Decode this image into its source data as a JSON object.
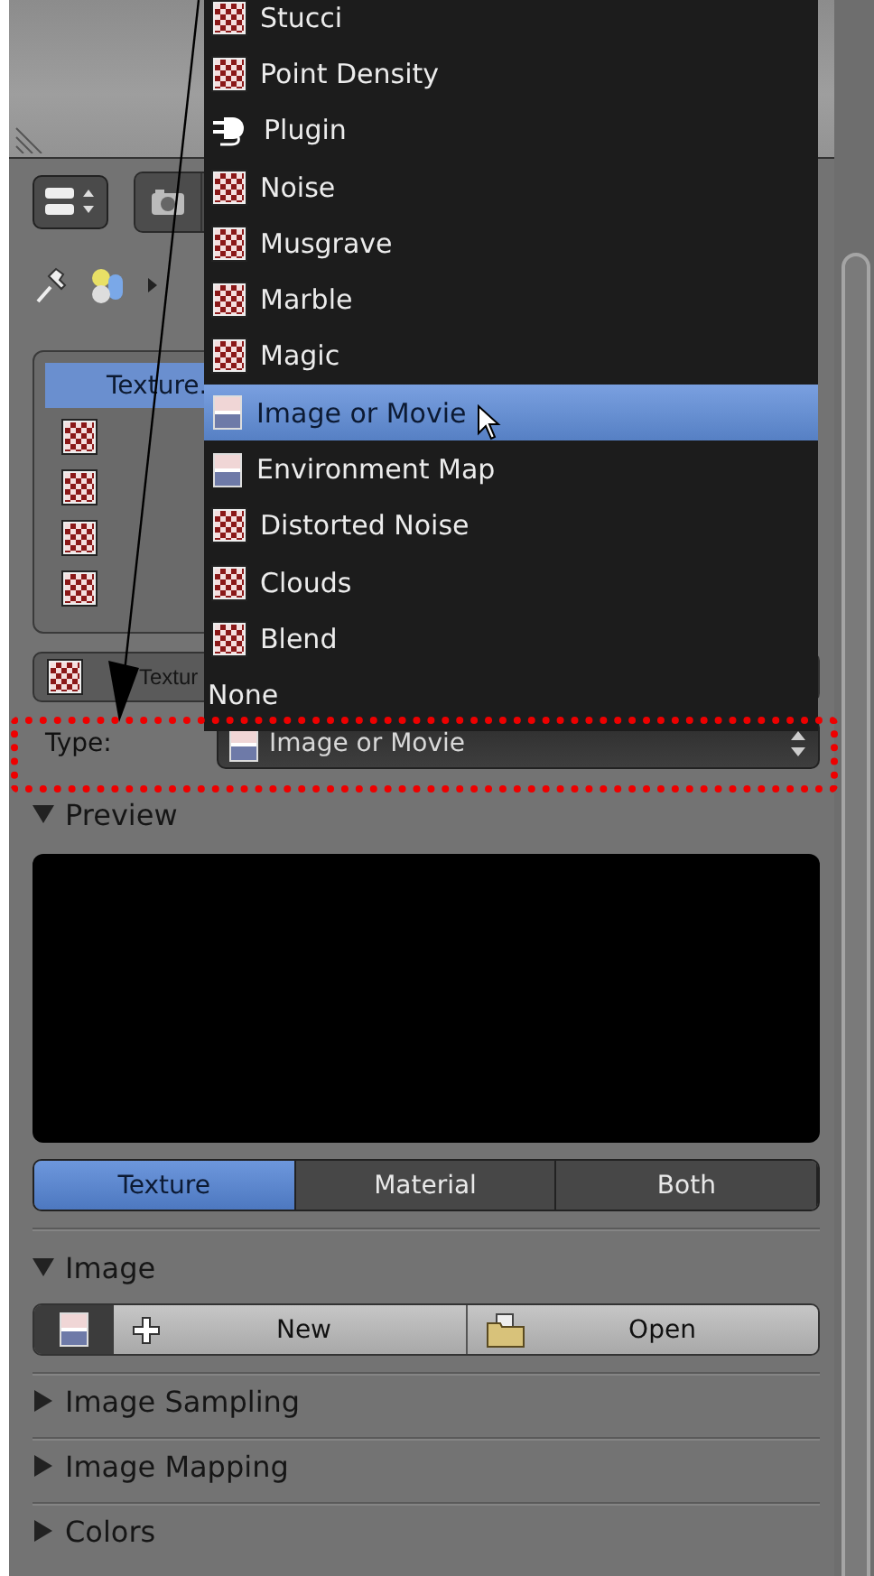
{
  "texture_slots": [
    {
      "label": "Texture.",
      "selected": true
    },
    {
      "selected": false
    },
    {
      "selected": false
    },
    {
      "selected": false
    },
    {
      "selected": false
    }
  ],
  "datablock": {
    "name": "Textur"
  },
  "type_field": {
    "label": "Type:",
    "value": "Image or Movie"
  },
  "preview": {
    "title": "Preview",
    "expanded": true,
    "modes": [
      {
        "label": "Texture",
        "selected": true
      },
      {
        "label": "Material",
        "selected": false
      },
      {
        "label": "Both",
        "selected": false
      }
    ]
  },
  "image_panel": {
    "title": "Image",
    "expanded": true,
    "buttons": [
      "New",
      "Open"
    ]
  },
  "collapsed_panels": [
    {
      "title": "Image Sampling",
      "expanded": false
    },
    {
      "title": "Image Mapping",
      "expanded": false
    },
    {
      "title": "Colors",
      "expanded": false
    }
  ],
  "dropdown_menu": {
    "items": [
      {
        "label": "Stucci",
        "kind": "checker",
        "selected": false
      },
      {
        "label": "Point Density",
        "kind": "checker",
        "selected": false
      },
      {
        "label": "Plugin",
        "kind": "plugin",
        "selected": false
      },
      {
        "label": "Noise",
        "kind": "checker",
        "selected": false
      },
      {
        "label": "Musgrave",
        "kind": "checker",
        "selected": false
      },
      {
        "label": "Marble",
        "kind": "checker",
        "selected": false
      },
      {
        "label": "Magic",
        "kind": "checker",
        "selected": false
      },
      {
        "label": "Image or Movie",
        "kind": "image",
        "selected": true
      },
      {
        "label": "Environment Map",
        "kind": "image",
        "selected": false
      },
      {
        "label": "Distorted Noise",
        "kind": "checker",
        "selected": false
      },
      {
        "label": "Clouds",
        "kind": "checker",
        "selected": false
      },
      {
        "label": "Blend",
        "kind": "checker",
        "selected": false
      },
      {
        "label": "None",
        "kind": "none",
        "selected": false
      }
    ]
  }
}
